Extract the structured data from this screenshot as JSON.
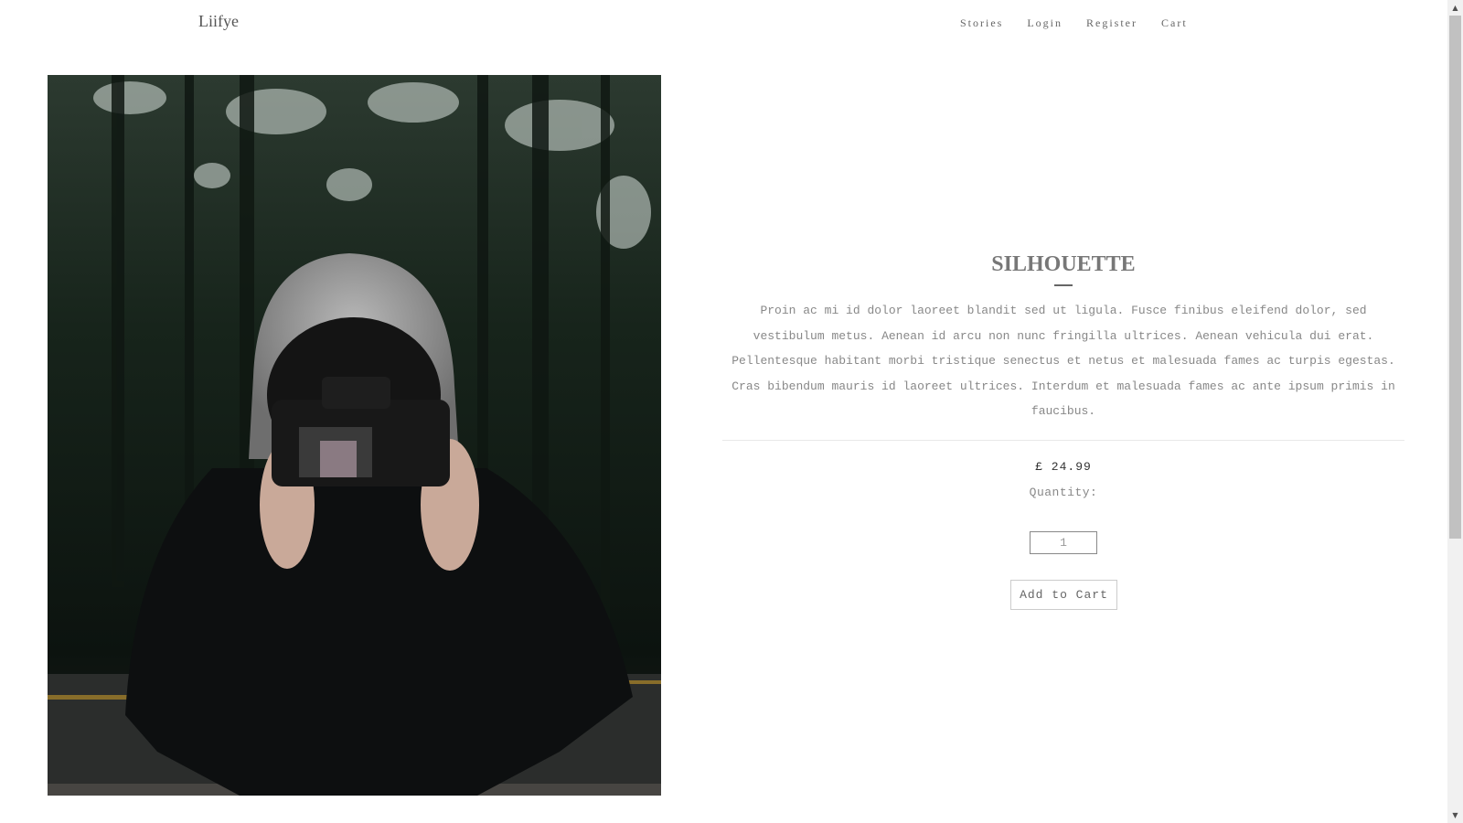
{
  "header": {
    "brand": "Liifye",
    "nav": [
      "Stories",
      "Login",
      "Register",
      "Cart"
    ]
  },
  "product": {
    "title": "SILHOUETTE",
    "description": "Proin ac mi id dolor laoreet blandit sed ut ligula. Fusce finibus eleifend dolor, sed vestibulum metus. Aenean id arcu non nunc fringilla ultrices. Aenean vehicula dui erat. Pellentesque habitant morbi tristique senectus et netus et malesuada fames ac turpis egestas. Cras bibendum mauris id laoreet ultrices. Interdum et malesuada fames ac ante ipsum primis in faucibus.",
    "price": "£ 24.99",
    "quantity_label": "Quantity:",
    "quantity_value": "1",
    "add_to_cart_label": "Add to Cart"
  },
  "colors": {
    "text": "#666666",
    "border": "#cccccc",
    "background": "#ffffff"
  }
}
